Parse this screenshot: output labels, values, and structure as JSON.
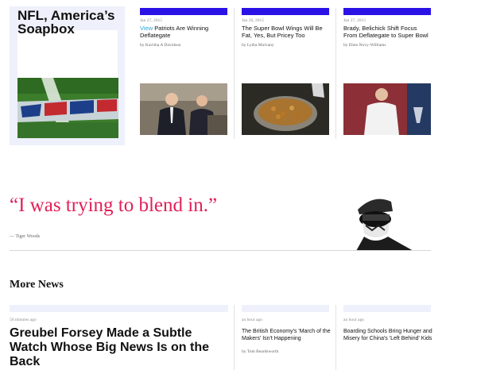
{
  "feature": {
    "title": "NFL, America’s Soapbox"
  },
  "cards": [
    {
      "date": "Jan 27, 2015",
      "tag": "View",
      "headline": "Patriots Are Winning Deflategate",
      "byline": "by Kavitha A Davidson"
    },
    {
      "date": "Jan 26, 2015",
      "tag": "",
      "headline": "The Super Bowl Wings Will Be Fat, Yes, But Pricey Too",
      "byline": "by Lydia Mulvany"
    },
    {
      "date": "Jan 27, 2015",
      "tag": "",
      "headline": "Brady, Belichick Shift Focus From Deflategate to Super Bowl",
      "byline": "by Eben Novy-Williams"
    }
  ],
  "quote": {
    "text": "“I was trying to blend in.”",
    "attribution": "— Tiger Woods"
  },
  "more_news": {
    "title": "More News",
    "items": [
      {
        "date": "50 minutes ago",
        "headline": "Greubel Forsey Made a Subtle Watch Whose Big News Is on the Back",
        "byline": ""
      },
      {
        "date": "an hour ago",
        "headline": "The British Economy's 'March of the Makers' Isn't Happening",
        "byline": "by Tom Beardsworth"
      },
      {
        "date": "an hour ago",
        "headline": "Boarding Schools Bring Hunger and Misery for China's 'Left Behind' Kids",
        "byline": ""
      }
    ]
  },
  "colors": {
    "accent_bar": "#2a12e6",
    "quote": "#e21f58",
    "tag": "#2aa3d6",
    "panel": "#eef1fb"
  }
}
